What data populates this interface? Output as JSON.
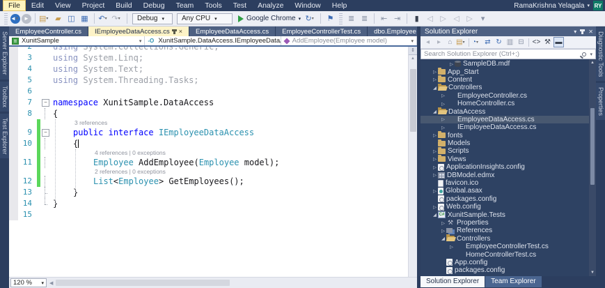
{
  "menu_bar": {
    "items": [
      "File",
      "Edit",
      "View",
      "Project",
      "Build",
      "Debug",
      "Team",
      "Tools",
      "Test",
      "Analyze",
      "Window",
      "Help"
    ],
    "active_item": "File",
    "user_name": "RamaKrishna Yelagala",
    "user_initials": "RY"
  },
  "toolbar": {
    "items": [
      {
        "t": "grip"
      },
      {
        "t": "icon",
        "name": "navigate-backward",
        "glyph": "◄",
        "cls": "cir-blue",
        "caret": true
      },
      {
        "t": "icon",
        "name": "navigate-forward",
        "glyph": "►",
        "cls": "cir-gray"
      },
      {
        "t": "sep"
      },
      {
        "t": "icon",
        "name": "new-project",
        "glyph": "▤",
        "cls": "c-tan",
        "caret": true
      },
      {
        "t": "icon",
        "name": "open-file",
        "glyph": "▰",
        "cls": "c-tan"
      },
      {
        "t": "icon",
        "name": "save",
        "glyph": "◫",
        "cls": "c-blue"
      },
      {
        "t": "icon",
        "name": "save-all",
        "glyph": "▦",
        "cls": "c-blue"
      },
      {
        "t": "sep"
      },
      {
        "t": "icon",
        "name": "undo",
        "glyph": "↶",
        "cls": "c-blue",
        "caret": true
      },
      {
        "t": "icon",
        "name": "redo",
        "glyph": "↷",
        "cls": "c-dim",
        "caret": true
      },
      {
        "t": "sep"
      },
      {
        "t": "combo",
        "name": "debug-configuration",
        "label": "Debug"
      },
      {
        "t": "combo",
        "name": "solution-platform",
        "label": "Any CPU"
      },
      {
        "t": "run",
        "name": "start-debugging",
        "label": "Google Chrome"
      },
      {
        "t": "icon",
        "name": "browser-link-refresh",
        "glyph": "↻",
        "cls": "c-blue",
        "caret": true
      },
      {
        "t": "sep"
      },
      {
        "t": "icon",
        "name": "find-in-files",
        "glyph": "⚑",
        "cls": "c-blue"
      },
      {
        "t": "grip"
      },
      {
        "t": "icon",
        "name": "line-comment",
        "glyph": "≣",
        "cls": "c-dim2"
      },
      {
        "t": "icon",
        "name": "line-uncomment",
        "glyph": "≣",
        "cls": "c-dim2"
      },
      {
        "t": "sep"
      },
      {
        "t": "icon",
        "name": "decrease-indent",
        "glyph": "⇤",
        "cls": "c-dim2"
      },
      {
        "t": "icon",
        "name": "increase-indent",
        "glyph": "⇥",
        "cls": "c-dim2"
      },
      {
        "t": "sep"
      },
      {
        "t": "icon",
        "name": "toggle-bookmark",
        "glyph": "▮",
        "cls": "c-dark"
      },
      {
        "t": "icon",
        "name": "previous-bookmark",
        "glyph": "◁",
        "cls": "c-dim"
      },
      {
        "t": "icon",
        "name": "next-bookmark",
        "glyph": "▷",
        "cls": "c-dim"
      },
      {
        "t": "icon",
        "name": "previous-bookmark-in-folder",
        "glyph": "◁",
        "cls": "c-dim"
      },
      {
        "t": "icon",
        "name": "next-bookmark-in-folder",
        "glyph": "▷",
        "cls": "c-dim"
      },
      {
        "t": "icon",
        "name": "toolbar-options",
        "glyph": "▾",
        "cls": "c-dim2"
      }
    ]
  },
  "left_tool_tabs": [
    "Server Explorer",
    "Toolbox",
    "Test Explorer"
  ],
  "right_tool_tabs": [
    "Diagnostic Tools",
    "Properties"
  ],
  "editor": {
    "tabs": [
      {
        "label": "EmployeeController.cs",
        "active": false
      },
      {
        "label": "IEmployeeDataAccess.cs",
        "active": true
      },
      {
        "label": "EmployeeDataAccess.cs",
        "active": false
      },
      {
        "label": "EmployeeControllerTest.cs",
        "active": false
      },
      {
        "label": "dbo.Employee [Design]",
        "active": false
      }
    ],
    "navbar": [
      {
        "name": "project-selector",
        "icon": "proj",
        "label": "XunitSample",
        "dim": false
      },
      {
        "name": "type-selector",
        "icon": "iface",
        "label": "XunitSample.DataAccess.IEmployeeDataAccess",
        "dim": false
      },
      {
        "name": "member-selector",
        "icon": "method",
        "label": "AddEmployee(Employee model)",
        "dim": true
      }
    ],
    "iface_icon_text": "-O",
    "zoom_level": "120 %",
    "lines": [
      {
        "n": 2,
        "ind": 0,
        "segs": [
          [
            "ukw",
            "using"
          ],
          [
            "gray",
            " System.Collections.Generic;"
          ]
        ],
        "out": ""
      },
      {
        "n": 3,
        "ind": 0,
        "segs": [
          [
            "ukw",
            "using"
          ],
          [
            "gray",
            " System.Linq;"
          ]
        ],
        "out": ""
      },
      {
        "n": 4,
        "ind": 0,
        "segs": [
          [
            "ukw",
            "using"
          ],
          [
            "gray",
            " System.Text;"
          ]
        ],
        "out": ""
      },
      {
        "n": 5,
        "ind": 0,
        "segs": [
          [
            "ukw",
            "using"
          ],
          [
            "gray",
            " System.Threading.Tasks;"
          ]
        ],
        "out": ""
      },
      {
        "n": 6,
        "ind": 0,
        "segs": [],
        "out": ""
      },
      {
        "n": 7,
        "ind": 0,
        "segs": [
          [
            "kw",
            "namespace"
          ],
          [
            "pln",
            " XunitSample.DataAccess"
          ]
        ],
        "out": "box"
      },
      {
        "n": 8,
        "ind": 0,
        "segs": [
          [
            "pln",
            "{"
          ]
        ],
        "out": "line"
      },
      {
        "n": 9,
        "ind": 1,
        "lens": "3 references",
        "segs": [
          [
            "kw",
            "public"
          ],
          [
            "pln",
            " "
          ],
          [
            "kw",
            "interface"
          ],
          [
            "pln",
            " "
          ],
          [
            "typ",
            "IEmployeeDataAccess"
          ]
        ],
        "out": "box",
        "chg": true
      },
      {
        "n": 10,
        "ind": 1,
        "segs": [
          [
            "pln",
            "{"
          ]
        ],
        "out": "line",
        "chg": true,
        "cursor": true
      },
      {
        "n": 11,
        "ind": 2,
        "lens": "4 references | 0 exceptions",
        "segs": [
          [
            "typ",
            "Employee"
          ],
          [
            "pln",
            " AddEmployee("
          ],
          [
            "typ",
            "Employee"
          ],
          [
            "pln",
            " model);"
          ]
        ],
        "out": "line",
        "chg": true
      },
      {
        "n": 12,
        "ind": 2,
        "lens": "2 references | 0 exceptions",
        "segs": [
          [
            "typ",
            "List"
          ],
          [
            "pln",
            "<"
          ],
          [
            "typ",
            "Employee"
          ],
          [
            "pln",
            "> GetEmployees();"
          ]
        ],
        "out": "line",
        "chg": true
      },
      {
        "n": 13,
        "ind": 1,
        "segs": [
          [
            "pln",
            "}"
          ]
        ],
        "out": "cornerline"
      },
      {
        "n": 14,
        "ind": 0,
        "segs": [
          [
            "pln",
            "}"
          ]
        ],
        "out": "corner"
      },
      {
        "n": 15,
        "ind": 0,
        "segs": [],
        "out": ""
      }
    ]
  },
  "solution_explorer": {
    "title": "Solution Explorer",
    "search_placeholder": "Search Solution Explorer (Ctrl+;)",
    "toolbar_icons": [
      {
        "t": "icon",
        "name": "se-navigate-backward",
        "glyph": "◂",
        "cls": "c-dim"
      },
      {
        "t": "icon",
        "name": "se-navigate-forward",
        "glyph": "▸",
        "cls": "c-dim"
      },
      {
        "t": "icon",
        "name": "se-home",
        "glyph": "⌂",
        "cls": "c-dim2"
      },
      {
        "t": "icon",
        "name": "se-switch-views",
        "glyph": "▤",
        "cls": "c-tan",
        "caret": true
      },
      {
        "t": "sep"
      },
      {
        "t": "icon",
        "name": "se-pending-changes-filter",
        "glyph": "◔",
        "cls": "c-blue",
        "caret": true
      },
      {
        "t": "icon",
        "name": "se-sync-with-active-document",
        "glyph": "⇄",
        "cls": "c-blue"
      },
      {
        "t": "icon",
        "name": "se-refresh",
        "glyph": "↻",
        "cls": "c-blue"
      },
      {
        "t": "icon",
        "name": "se-nest-files",
        "glyph": "▥",
        "cls": "c-dim2"
      },
      {
        "t": "icon",
        "name": "se-collapse-all",
        "glyph": "⊟",
        "cls": "c-dim2"
      },
      {
        "t": "sep"
      },
      {
        "t": "icon",
        "name": "se-view-code",
        "glyph": "<>",
        "cls": "c-dark"
      },
      {
        "t": "icon",
        "name": "se-properties",
        "glyph": "⚒",
        "cls": "c-dark"
      },
      {
        "t": "icon",
        "name": "se-show-all-files",
        "glyph": "▬",
        "cls": "c-dark",
        "selected": true
      }
    ],
    "tree": [
      {
        "label": "SampleDB.mdf",
        "icon": "db",
        "level": 3,
        "arrow": "c"
      },
      {
        "label": "App_Start",
        "icon": "folder",
        "level": 1,
        "arrow": "c"
      },
      {
        "label": "Content",
        "icon": "folder",
        "level": 1,
        "arrow": "c"
      },
      {
        "label": "Controllers",
        "icon": "folder-open",
        "level": 1,
        "arrow": "e"
      },
      {
        "label": "EmployeeController.cs",
        "icon": "cs",
        "level": 2,
        "arrow": "c"
      },
      {
        "label": "HomeController.cs",
        "icon": "cs",
        "level": 2,
        "arrow": "c"
      },
      {
        "label": "DataAccess",
        "icon": "folder-open",
        "level": 1,
        "arrow": "e"
      },
      {
        "label": "EmployeeDataAccess.cs",
        "icon": "cs",
        "level": 2,
        "arrow": "c",
        "selected": true
      },
      {
        "label": "IEmployeeDataAccess.cs",
        "icon": "cs",
        "level": 2,
        "arrow": "c"
      },
      {
        "label": "fonts",
        "icon": "folder",
        "level": 1,
        "arrow": "c"
      },
      {
        "label": "Models",
        "icon": "folder",
        "level": 1,
        "arrow": "n"
      },
      {
        "label": "Scripts",
        "icon": "folder",
        "level": 1,
        "arrow": "c"
      },
      {
        "label": "Views",
        "icon": "folder",
        "level": 1,
        "arrow": "c"
      },
      {
        "label": "ApplicationInsights.config",
        "icon": "config",
        "level": 1,
        "arrow": "c"
      },
      {
        "label": "DBModel.edmx",
        "icon": "edmx",
        "level": 1,
        "arrow": "c"
      },
      {
        "label": "favicon.ico",
        "icon": "file",
        "level": 1,
        "arrow": "n"
      },
      {
        "label": "Global.asax",
        "icon": "asax",
        "level": 1,
        "arrow": "c"
      },
      {
        "label": "packages.config",
        "icon": "config",
        "level": 1,
        "arrow": "n"
      },
      {
        "label": "Web.config",
        "icon": "config",
        "level": 1,
        "arrow": "c"
      },
      {
        "label": "XunitSample.Tests",
        "icon": "proj",
        "level": 1,
        "arrow": "e"
      },
      {
        "label": "Properties",
        "icon": "wrench",
        "level": 2,
        "arrow": "c"
      },
      {
        "label": "References",
        "icon": "refs",
        "level": 2,
        "arrow": "c"
      },
      {
        "label": "Controllers",
        "icon": "folder-open",
        "level": 2,
        "arrow": "e"
      },
      {
        "label": "EmployeeControllerTest.cs",
        "icon": "cs",
        "level": 3,
        "arrow": "c"
      },
      {
        "label": "HomeControllerTest.cs",
        "icon": "cs",
        "level": 3,
        "arrow": "n"
      },
      {
        "label": "App.config",
        "icon": "config",
        "level": 2,
        "arrow": "n"
      },
      {
        "label": "packages.config",
        "icon": "config",
        "level": 2,
        "arrow": "n"
      }
    ],
    "bottom_tabs": [
      {
        "label": "Solution Explorer",
        "active": true
      },
      {
        "label": "Team Explorer",
        "active": false
      }
    ]
  }
}
